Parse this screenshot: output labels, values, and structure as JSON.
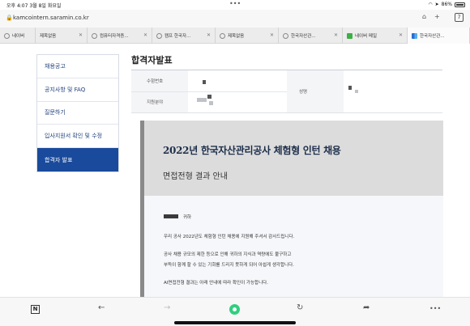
{
  "status": {
    "time": "오후 4:07",
    "date": "3월 8일 화요일",
    "battery": "86%"
  },
  "url": {
    "host": "kamcointern.saramin.co.kr",
    "tab_count": "7"
  },
  "tabs": [
    {
      "label": "네이버"
    },
    {
      "label": "제목없음"
    },
    {
      "label": "컴퓨터자격증..."
    },
    {
      "label": "캠프 한국자..."
    },
    {
      "label": "제목없음"
    },
    {
      "label": "한국자산관..."
    },
    {
      "label": "네이버 메일"
    },
    {
      "label": "한국자산관..."
    }
  ],
  "sidebar": {
    "items": [
      {
        "label": "채용공고"
      },
      {
        "label": "공지사항 및 FAQ"
      },
      {
        "label": "질문하기"
      },
      {
        "label": "입사지원서 확인 및 수정"
      },
      {
        "label": "합격자 발표"
      }
    ]
  },
  "page": {
    "title": "합격자발표"
  },
  "info": {
    "applicant_no_label": "수험번호",
    "field_label": "지원분야",
    "name_label": "성명"
  },
  "notice": {
    "title": "2022년 한국자산관리공사 체험형 인턴 채용",
    "subtitle": "면접전형 결과 안내",
    "greeting": "귀하",
    "para1": "우리 공사 2022년도 체험형 인턴 채용에 지원해 주셔서 감사드립니다.",
    "para2a": "공사 채용 규모의 제한 등으로 인해 귀하의 지식과 역량에도 불구하고",
    "para2b": "부득이 함께 할 수 있는 기회를 드리지 못하게 되어 아쉽게 생각합니다.",
    "para3": "AI면접전형 결과는 아래 안내에 따라 확인이 가능합니다."
  },
  "toolbar": {
    "n_label": "N"
  }
}
